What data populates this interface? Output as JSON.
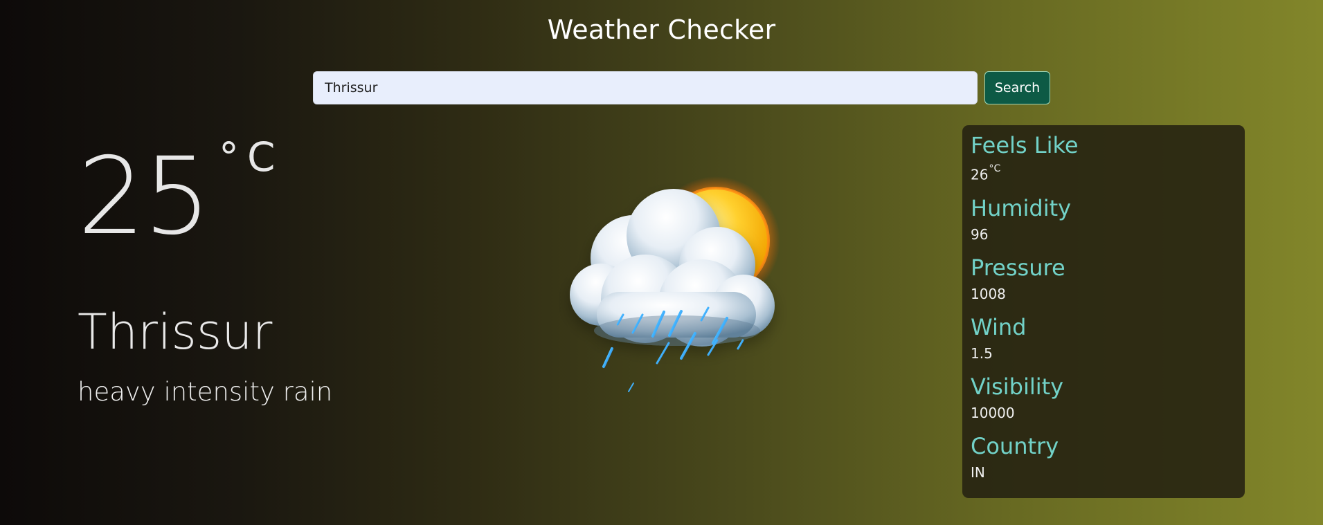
{
  "app": {
    "title": "Weather Checker"
  },
  "search": {
    "value": "Thrissur",
    "placeholder": "",
    "button_label": "Search"
  },
  "current": {
    "temperature": "25",
    "unit": "°C",
    "city": "Thrissur",
    "description": "heavy intensity rain",
    "icon": "sun-cloud-rain-icon"
  },
  "details": {
    "feels_like": {
      "label": "Feels Like",
      "value": "26",
      "unit": "°C"
    },
    "humidity": {
      "label": "Humidity",
      "value": "96"
    },
    "pressure": {
      "label": "Pressure",
      "value": "1008"
    },
    "wind": {
      "label": "Wind",
      "value": "1.5"
    },
    "visibility": {
      "label": "Visibility",
      "value": "10000"
    },
    "country": {
      "label": "Country",
      "value": "IN"
    }
  },
  "colors": {
    "detail_label": "#72d2c8",
    "search_button": "#0d5a45",
    "search_input_bg": "#e8eefc",
    "card_bg": "#242111"
  }
}
